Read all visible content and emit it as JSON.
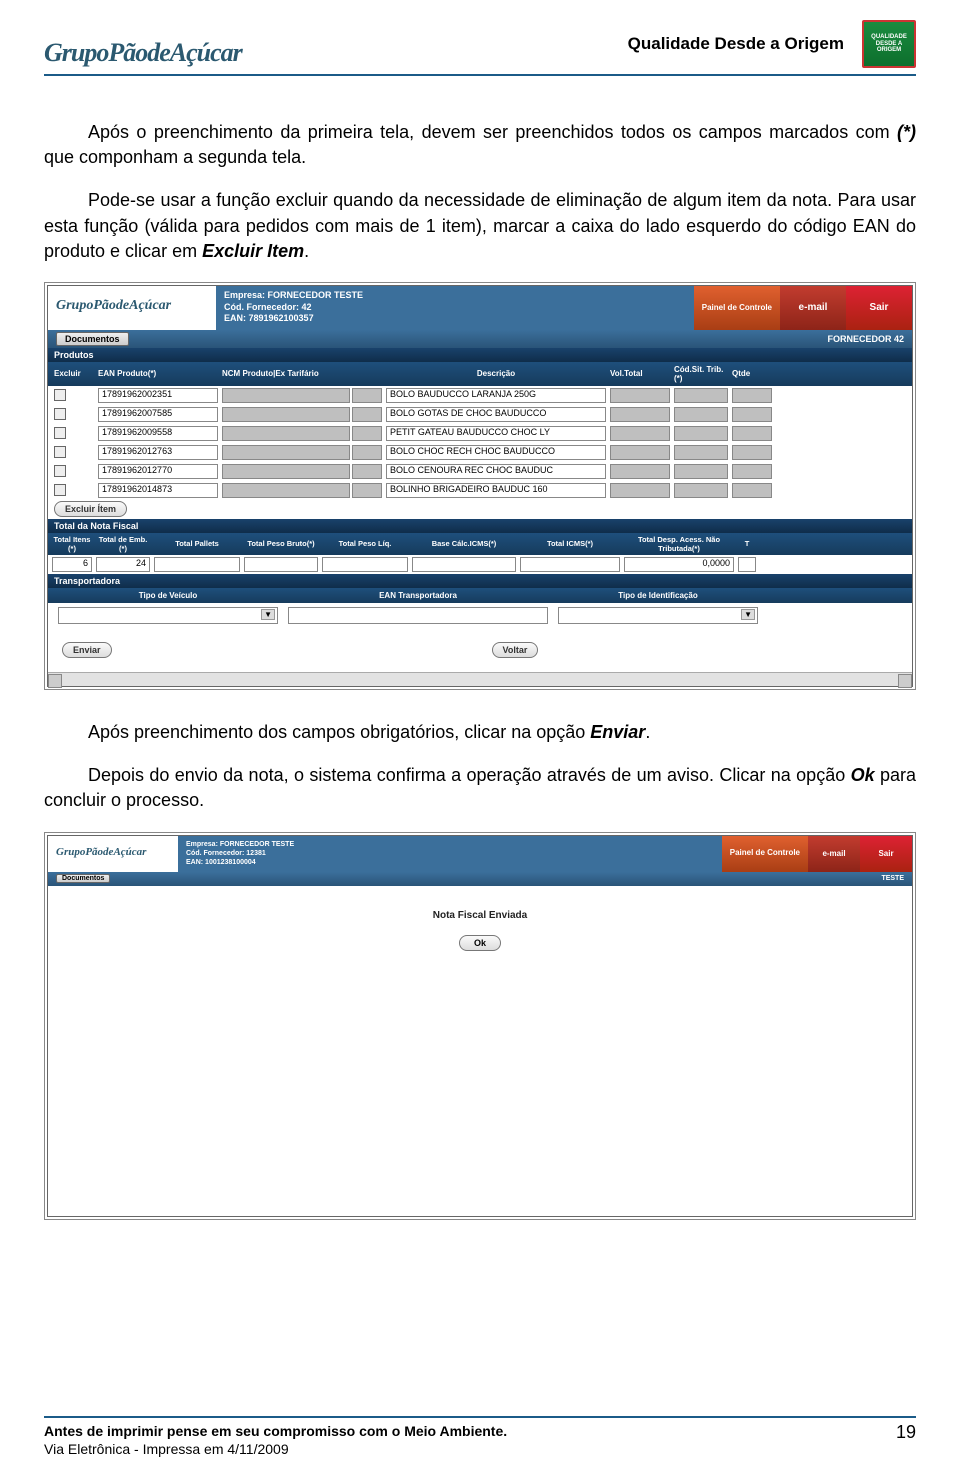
{
  "header": {
    "brand": "GrupoPãodeAçúcar",
    "title": "Qualidade Desde a Origem",
    "badge_line1": "QUALIDADE",
    "badge_line2": "DESDE A",
    "badge_line3": "ORIGEM"
  },
  "body": {
    "p1a": "Após o preenchimento da primeira tela, devem ser preenchidos todos os campos marcados com ",
    "p1b": "(*)",
    "p1c": " que componham  a segunda tela.",
    "p2a": "Pode-se usar a função excluir quando da necessidade de eliminação de algum item da nota. Para usar esta função (válida para pedidos com mais de 1 item), marcar a caixa do lado esquerdo do código EAN do produto e clicar em ",
    "p2b": "Excluir Item",
    "p2c": ".",
    "p3a": "Após preenchimento dos campos obrigatórios, clicar na opção ",
    "p3b": "Enviar",
    "p3c": ".",
    "p4a": "Depois do envio da nota, o sistema confirma a operação através de um aviso. Clicar na opção ",
    "p4b": "Ok",
    "p4c": " para concluir o processo."
  },
  "shot1": {
    "logo": "GrupoPãodeAçúcar",
    "info_l1": "Empresa: FORNECEDOR TESTE",
    "info_l2": "Cód. Fornecedor: 42",
    "info_l3": "EAN: 7891962100357",
    "btn_painel": "Painel de Controle",
    "btn_email": "e-mail",
    "btn_sair": "Sair",
    "doc_btn": "Documentos",
    "sub_right": "FORNECEDOR 42",
    "band_prod": "Produtos",
    "cols": {
      "c1": "Excluir",
      "c2": "EAN Produto(*)",
      "c3": "NCM Produto|Ex Tarifário",
      "c4": "Descrição",
      "c5": "Vol.Total",
      "c6": "Cód.Sit. Trib.(*)",
      "c7": "Qtde"
    },
    "rows": [
      {
        "ean": "17891962002351",
        "desc": "BOLO BAUDUCCO LARANJA 250G"
      },
      {
        "ean": "17891962007585",
        "desc": "BOLO GOTAS DE CHOC BAUDUCCO"
      },
      {
        "ean": "17891962009558",
        "desc": "PETIT GATEAU BAUDUCCO CHOC LY"
      },
      {
        "ean": "17891962012763",
        "desc": "BOLO CHOC RECH CHOC BAUDUCCO"
      },
      {
        "ean": "17891962012770",
        "desc": "BOLO CENOURA REC CHOC BAUDUC"
      },
      {
        "ean": "17891962014873",
        "desc": "BOLINHO BRIGADEIRO BAUDUC 160"
      }
    ],
    "excl_btn": "Excluir Ítem",
    "band_total": "Total da Nota Fiscal",
    "tot_cols": {
      "c1": "Total Itens (*)",
      "c2": "Total de Emb.(*)",
      "c3": "Total Pallets",
      "c4": "Total Peso Bruto(*)",
      "c5": "Total Peso Líq.",
      "c6": "Base Cálc.ICMS(*)",
      "c7": "Total ICMS(*)",
      "c8": "Total Desp. Acess. Não Tributada(*)",
      "c9": "T"
    },
    "tot_vals": {
      "itens": "6",
      "emb": "24",
      "desp": "0,0000"
    },
    "band_tra": "Transportadora",
    "tr_cols": {
      "c1": "Tipo de Veículo",
      "c2": "EAN Transportadora",
      "c3": "Tipo de Identificação"
    },
    "enviar": "Enviar",
    "voltar": "Voltar"
  },
  "shot2": {
    "logo": "GrupoPãodeAçúcar",
    "info_l1": "Empresa: FORNECEDOR TESTE",
    "info_l2": "Cód. Fornecedor: 12381",
    "info_l3": "EAN: 1001238100004",
    "btn_painel": "Painel de Controle",
    "btn_email": "e-mail",
    "btn_sair": "Sair",
    "doc_btn": "Documentos",
    "sub_right": "TESTE",
    "title": "Nota Fiscal Enviada",
    "ok": "Ok"
  },
  "footer": {
    "l1": "Antes de imprimir pense em seu compromisso com o Meio Ambiente.",
    "l2": "Via Eletrônica -  Impressa em 4/11/2009",
    "page": "19"
  }
}
